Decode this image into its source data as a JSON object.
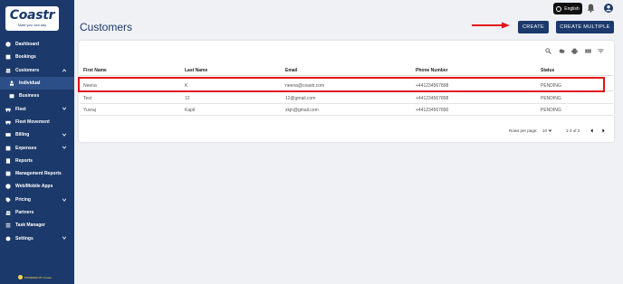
{
  "brand": {
    "logo": "Coastr",
    "tagline": "Make your own way",
    "powered_by": "POWERED BY Coastr"
  },
  "topbar": {
    "language": "English"
  },
  "sidebar": {
    "items": [
      {
        "label": "Dashboard",
        "icon": "dashboard-icon"
      },
      {
        "label": "Bookings",
        "icon": "bookings-icon"
      },
      {
        "label": "Customers",
        "icon": "customers-icon"
      },
      {
        "label": "Individual",
        "icon": "individual-icon"
      },
      {
        "label": "Business",
        "icon": "business-icon"
      },
      {
        "label": "Fleet",
        "icon": "fleet-icon"
      },
      {
        "label": "Fleet Movement",
        "icon": "fleet-movement-icon"
      },
      {
        "label": "Billing",
        "icon": "billing-icon"
      },
      {
        "label": "Expenses",
        "icon": "expenses-icon"
      },
      {
        "label": "Reports",
        "icon": "reports-icon"
      },
      {
        "label": "Management Reports",
        "icon": "management-reports-icon"
      },
      {
        "label": "Web/Mobile Apps",
        "icon": "apps-icon"
      },
      {
        "label": "Pricing",
        "icon": "pricing-icon"
      },
      {
        "label": "Partners",
        "icon": "partners-icon"
      },
      {
        "label": "Task Manager",
        "icon": "task-manager-icon"
      },
      {
        "label": "Settings",
        "icon": "settings-icon"
      }
    ]
  },
  "page": {
    "title": "Customers",
    "create_label": "CREATE",
    "create_multiple_label": "CREATE MULTIPLE"
  },
  "table": {
    "columns": [
      "First Name",
      "Last Name",
      "Email",
      "Phone Number",
      "Status"
    ],
    "rows": [
      [
        "Neena",
        "K",
        "neena@coastr.com",
        "+441234567898",
        "PENDING"
      ],
      [
        "Test",
        "12",
        "12@gmail.com",
        "+441234567898",
        "PENDING"
      ],
      [
        "Yuvraj",
        "Kapil",
        "zkjn@gmail.com",
        "+441234567890",
        "PENDING"
      ]
    ]
  },
  "pagination": {
    "rows_per_page_label": "Rows per page:",
    "rows_per_page": "10",
    "range": "1-3 of 3"
  },
  "colors": {
    "sidebar": "#1b3a6b",
    "accent": "#1b3a6b",
    "highlight": "#e21616"
  }
}
